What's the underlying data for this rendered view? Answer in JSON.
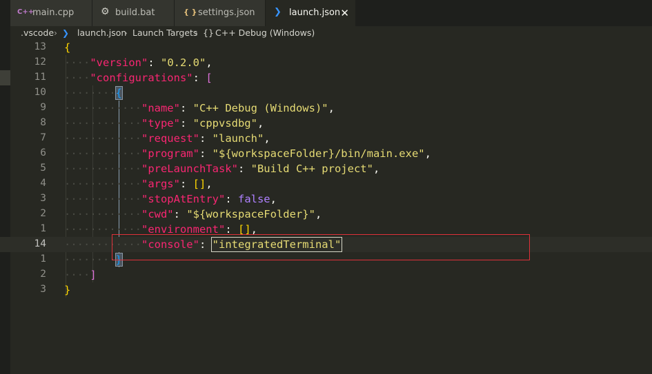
{
  "tabs": [
    {
      "label": "main.cpp",
      "icon": "C++"
    },
    {
      "label": "build.bat",
      "icon": "⚙"
    },
    {
      "label": "settings.json",
      "icon": "{ }"
    },
    {
      "label": "launch.json",
      "icon": "❯"
    }
  ],
  "breadcrumb": {
    "folder": ".vscode",
    "file": "launch.json",
    "section": "Launch Targets",
    "item_icon": "{}",
    "item": "C++ Debug (Windows)"
  },
  "lines": [
    {
      "n": "13"
    },
    {
      "n": "12"
    },
    {
      "n": "11"
    },
    {
      "n": "10"
    },
    {
      "n": "9"
    },
    {
      "n": "8"
    },
    {
      "n": "7"
    },
    {
      "n": "6"
    },
    {
      "n": "5"
    },
    {
      "n": "4"
    },
    {
      "n": "3"
    },
    {
      "n": "2"
    },
    {
      "n": "1"
    },
    {
      "n": "14"
    },
    {
      "n": "1"
    },
    {
      "n": "2"
    },
    {
      "n": "3"
    }
  ],
  "json": {
    "version_key": "\"version\"",
    "version_val": "\"0.2.0\"",
    "configurations_key": "\"configurations\"",
    "name_key": "\"name\"",
    "name_val": "\"C++ Debug (Windows)\"",
    "type_key": "\"type\"",
    "type_val": "\"cppvsdbg\"",
    "request_key": "\"request\"",
    "request_val": "\"launch\"",
    "program_key": "\"program\"",
    "program_val": "\"${workspaceFolder}/bin/main.exe\"",
    "prelaunch_key": "\"preLaunchTask\"",
    "prelaunch_val": "\"Build C++ project\"",
    "args_key": "\"args\"",
    "stop_key": "\"stopAtEntry\"",
    "stop_val": "false",
    "cwd_key": "\"cwd\"",
    "cwd_val": "\"${workspaceFolder}\"",
    "env_key": "\"environment\"",
    "console_key": "\"console\"",
    "console_val": "\"integratedTerminal\""
  },
  "colors": {
    "accent": "#f92672",
    "string": "#e6db74",
    "highlight_box": "#e0313a"
  }
}
